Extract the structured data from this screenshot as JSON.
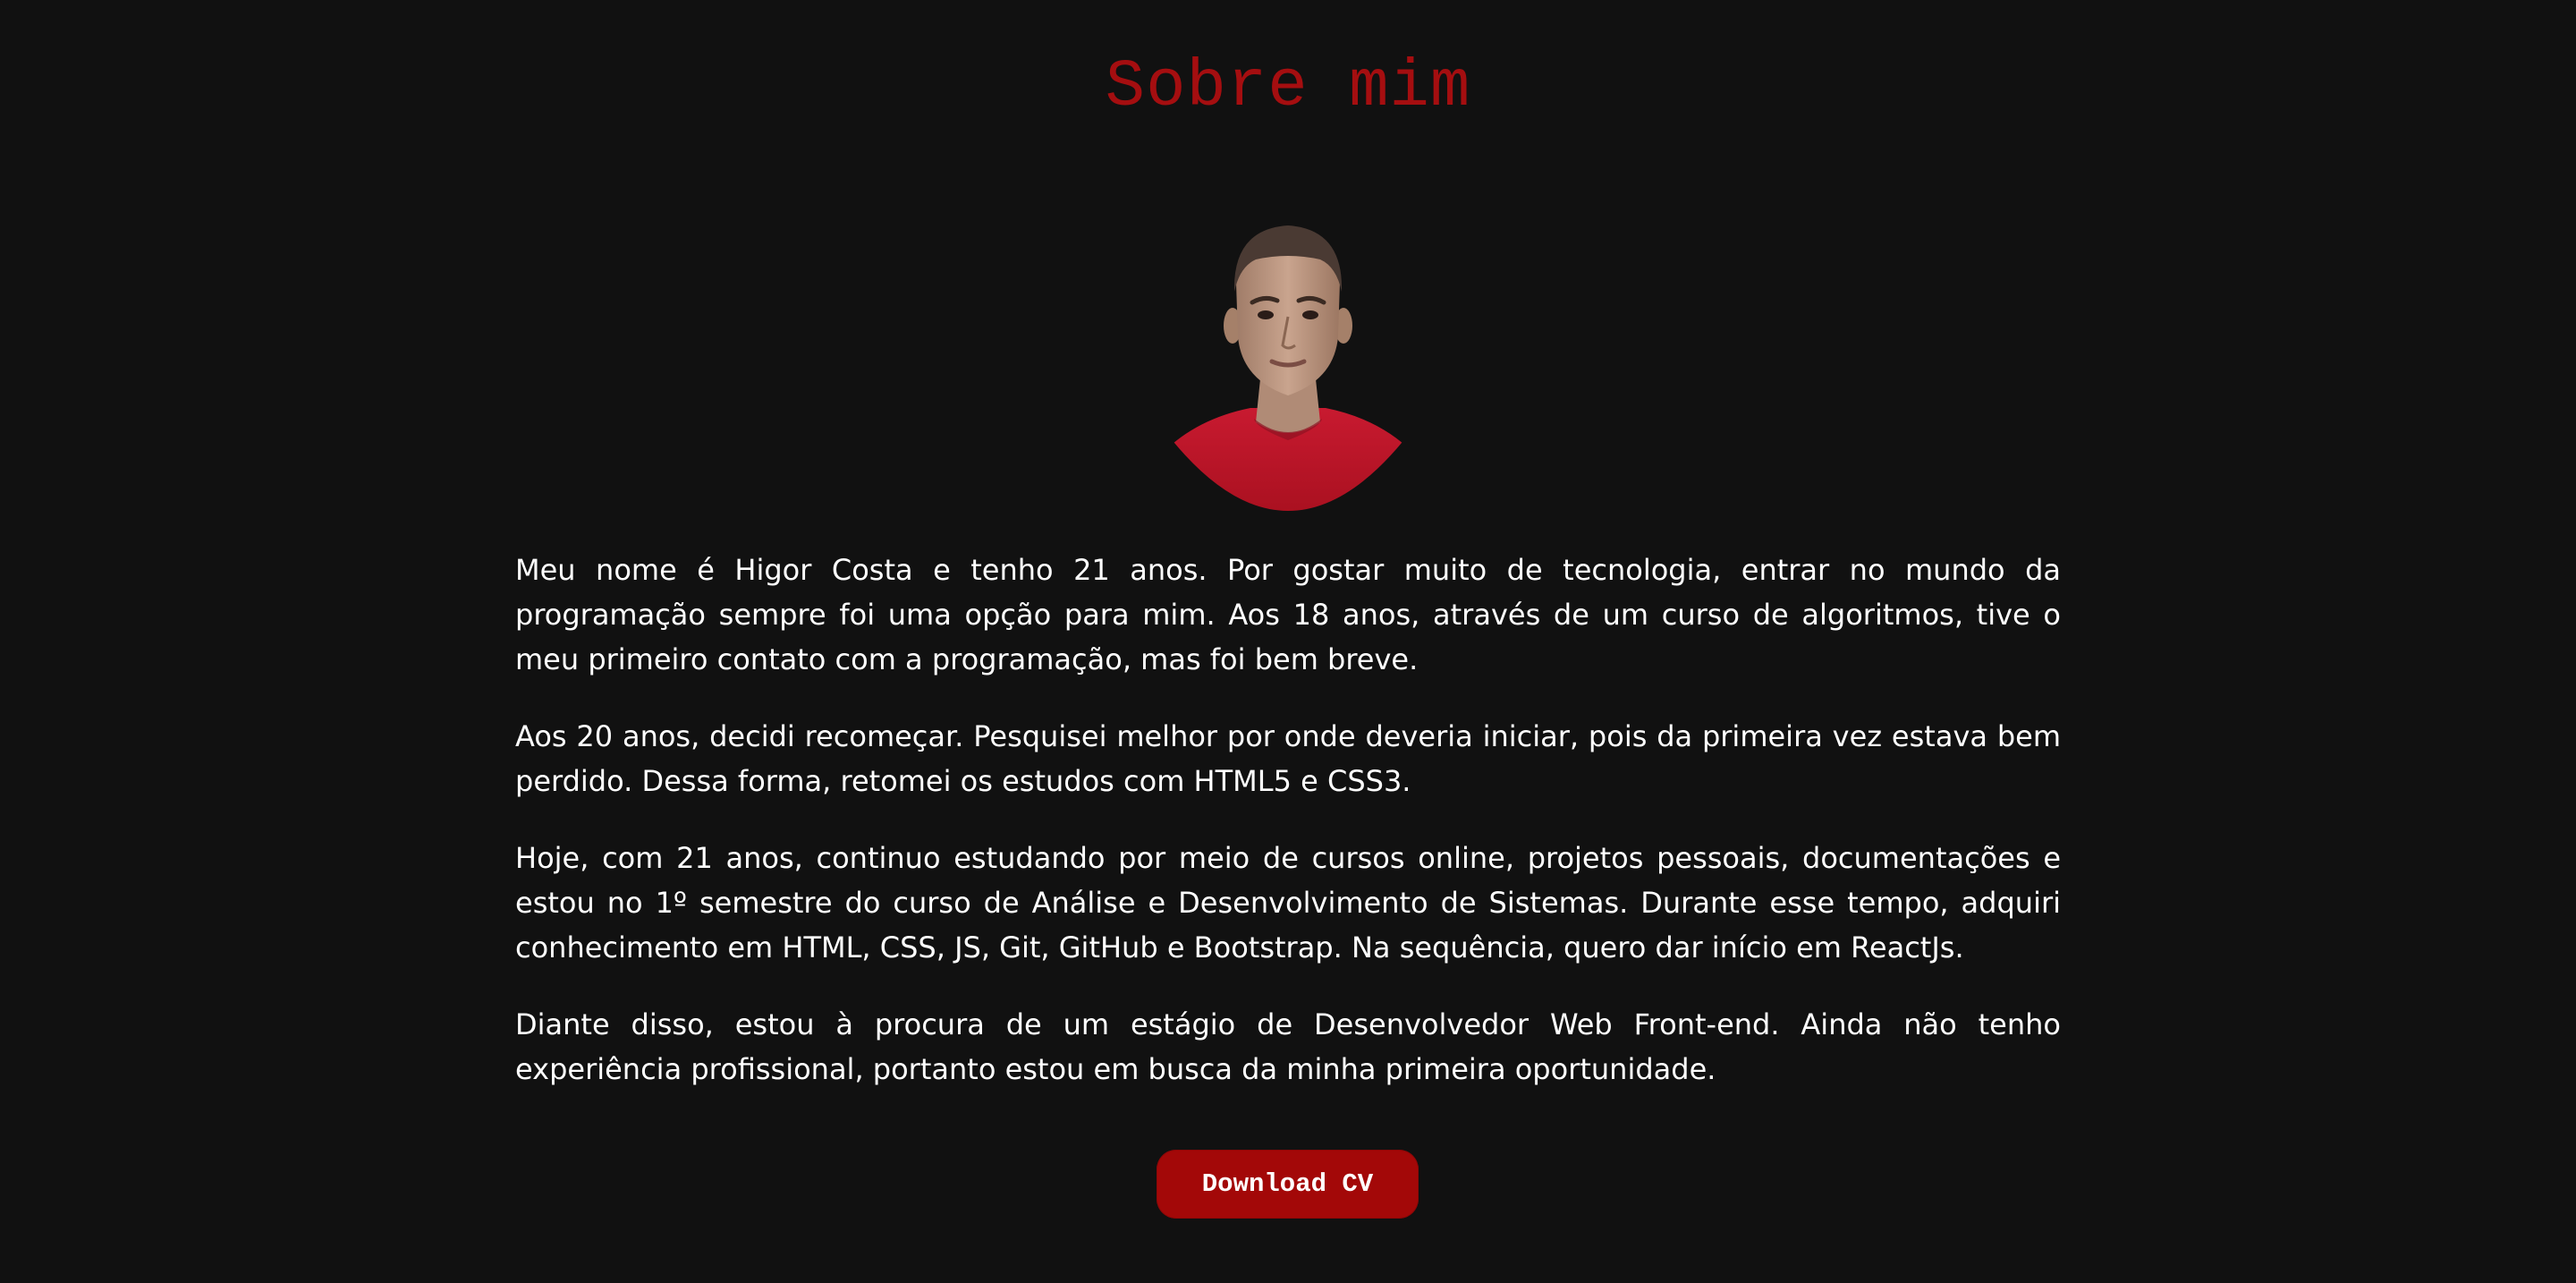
{
  "section": {
    "title": "Sobre mim"
  },
  "avatar": {
    "alt": "Foto de Higor Costa"
  },
  "about": {
    "paragraphs": [
      "Meu nome é Higor Costa e tenho 21 anos. Por gostar muito de tecnologia, entrar no mundo da programação sempre foi uma opção para mim. Aos 18 anos, através de um curso de algoritmos, tive o meu primeiro contato com a programação, mas foi bem breve.",
      "Aos 20 anos, decidi recomeçar. Pesquisei melhor por onde deveria iniciar, pois da primeira vez estava bem perdido. Dessa forma, retomei os estudos com HTML5 e CSS3.",
      "Hoje, com 21 anos, continuo estudando por meio de cursos online, projetos pessoais, documentações e estou no 1º semestre do curso de Análise e Desenvolvimento de Sistemas. Durante esse tempo, adquiri conhecimento em HTML, CSS, JS, Git, GitHub e Bootstrap. Na sequência, quero dar início em ReactJs.",
      "Diante disso, estou à procura de um estágio de Desenvolvedor Web Front-end. Ainda não tenho experiência profissional, portanto estou em busca da minha primeira oportunidade."
    ]
  },
  "download_button": {
    "label": "Download CV"
  },
  "colors": {
    "background": "#111111",
    "accent": "#a50e10",
    "button": "#a30808",
    "text": "#ffffff"
  }
}
